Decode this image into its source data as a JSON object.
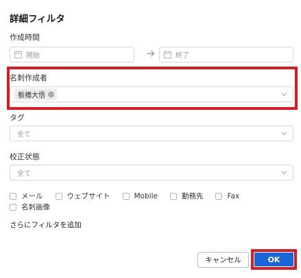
{
  "dialog": {
    "title": "詳細フィルタ"
  },
  "created_time": {
    "label": "作成時間",
    "start_placeholder": "開始",
    "end_placeholder": "終了",
    "calendar_icon": "calendar-icon",
    "arrow_icon": "arrow-right-icon"
  },
  "card_creator": {
    "label": "名刺作成者",
    "selected_chip": "板橋大悟",
    "chip_remove_icon": "remove-dot-icon"
  },
  "tag": {
    "label": "タグ",
    "value": "全て"
  },
  "proofread_status": {
    "label": "校正状態",
    "value": "全て"
  },
  "checkboxes": [
    "メール",
    "ウェブサイト",
    "Mobile",
    "勤務先",
    "Fax",
    "名刺画像"
  ],
  "add_filter_label": "さらにフィルタを追加",
  "buttons": {
    "cancel": "キャンセル",
    "ok": "OK"
  },
  "colors": {
    "highlight": "#e0181f",
    "primary": "#1768d6",
    "border": "#d6d6d6"
  }
}
